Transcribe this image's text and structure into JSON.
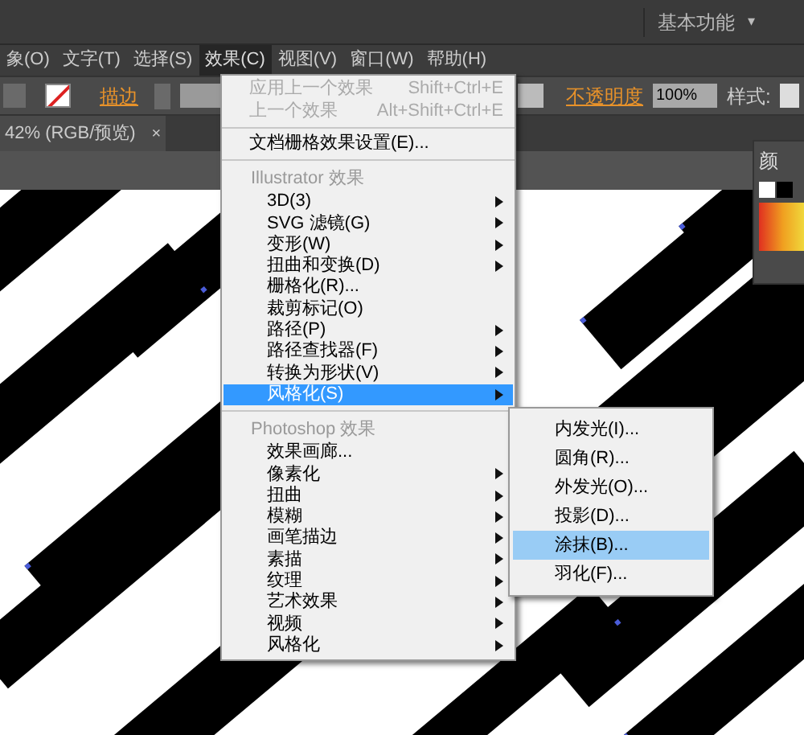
{
  "workspace_switcher": {
    "label": "基本功能",
    "caret": "▾"
  },
  "menubar": [
    {
      "label": "象(O)",
      "selected": false
    },
    {
      "label": "文字(T)",
      "selected": false
    },
    {
      "label": "选择(S)",
      "selected": false
    },
    {
      "label": "效果(C)",
      "selected": true
    },
    {
      "label": "视图(V)",
      "selected": false
    },
    {
      "label": "窗口(W)",
      "selected": false
    },
    {
      "label": "帮助(H)",
      "selected": false
    }
  ],
  "control_bar": {
    "stroke_label": "描边",
    "opacity_label": "不透明度",
    "opacity_value": "100%",
    "style_label": "样式:"
  },
  "document_tab": {
    "title": "42% (RGB/预览)",
    "close": "×"
  },
  "color_panel": {
    "title": "颜"
  },
  "effect_menu": [
    {
      "items": [
        {
          "label": "应用上一个效果",
          "shortcut": "Shift+Ctrl+E",
          "disabled": true,
          "submenu": false,
          "selected": false
        },
        {
          "label": "上一个效果",
          "shortcut": "Alt+Shift+Ctrl+E",
          "disabled": true,
          "submenu": false,
          "selected": false
        }
      ]
    },
    {
      "items": [
        {
          "label": "文档栅格效果设置(E)...",
          "disabled": false,
          "submenu": false,
          "selected": false
        }
      ]
    },
    {
      "header": "Illustrator 效果",
      "items": [
        {
          "label": "3D(3)",
          "disabled": false,
          "submenu": true,
          "selected": false
        },
        {
          "label": "SVG 滤镜(G)",
          "disabled": false,
          "submenu": true,
          "selected": false
        },
        {
          "label": "变形(W)",
          "disabled": false,
          "submenu": true,
          "selected": false
        },
        {
          "label": "扭曲和变换(D)",
          "disabled": false,
          "submenu": true,
          "selected": false
        },
        {
          "label": "栅格化(R)...",
          "disabled": false,
          "submenu": false,
          "selected": false
        },
        {
          "label": "裁剪标记(O)",
          "disabled": false,
          "submenu": false,
          "selected": false
        },
        {
          "label": "路径(P)",
          "disabled": false,
          "submenu": true,
          "selected": false
        },
        {
          "label": "路径查找器(F)",
          "disabled": false,
          "submenu": true,
          "selected": false
        },
        {
          "label": "转换为形状(V)",
          "disabled": false,
          "submenu": true,
          "selected": false
        },
        {
          "label": "风格化(S)",
          "disabled": false,
          "submenu": true,
          "selected": true
        }
      ]
    },
    {
      "header": "Photoshop 效果",
      "items": [
        {
          "label": "效果画廊...",
          "disabled": false,
          "submenu": false,
          "selected": false
        },
        {
          "label": "像素化",
          "disabled": false,
          "submenu": true,
          "selected": false
        },
        {
          "label": "扭曲",
          "disabled": false,
          "submenu": true,
          "selected": false
        },
        {
          "label": "模糊",
          "disabled": false,
          "submenu": true,
          "selected": false
        },
        {
          "label": "画笔描边",
          "disabled": false,
          "submenu": true,
          "selected": false
        },
        {
          "label": "素描",
          "disabled": false,
          "submenu": true,
          "selected": false
        },
        {
          "label": "纹理",
          "disabled": false,
          "submenu": true,
          "selected": false
        },
        {
          "label": "艺术效果",
          "disabled": false,
          "submenu": true,
          "selected": false
        },
        {
          "label": "视频",
          "disabled": false,
          "submenu": true,
          "selected": false
        },
        {
          "label": "风格化",
          "disabled": false,
          "submenu": true,
          "selected": false
        }
      ]
    }
  ],
  "stylize_submenu": [
    {
      "label": "内发光(I)...",
      "selected": false
    },
    {
      "label": "圆角(R)...",
      "selected": false
    },
    {
      "label": "外发光(O)...",
      "selected": false
    },
    {
      "label": "投影(D)...",
      "selected": false
    },
    {
      "label": "涂抹(B)...",
      "selected": true
    },
    {
      "label": "羽化(F)...",
      "selected": false
    }
  ]
}
